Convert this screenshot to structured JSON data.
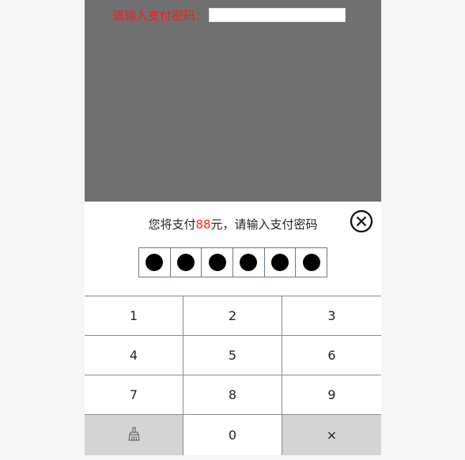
{
  "top": {
    "label": "请输入支付密码：",
    "input_value": ""
  },
  "dialog": {
    "prompt_prefix": "您将支付",
    "amount": "88",
    "prompt_suffix": "元，请输入支付密码",
    "entered_digits": 6
  },
  "keypad": {
    "k1": "1",
    "k2": "2",
    "k3": "3",
    "k4": "4",
    "k5": "5",
    "k6": "6",
    "k7": "7",
    "k8": "8",
    "k9": "9",
    "k0": "0",
    "delete": "×",
    "clear_icon": "broom-icon"
  },
  "colors": {
    "overlay": "#707070",
    "accent": "#ff1a1a",
    "key_gray": "#d4d4d4"
  }
}
